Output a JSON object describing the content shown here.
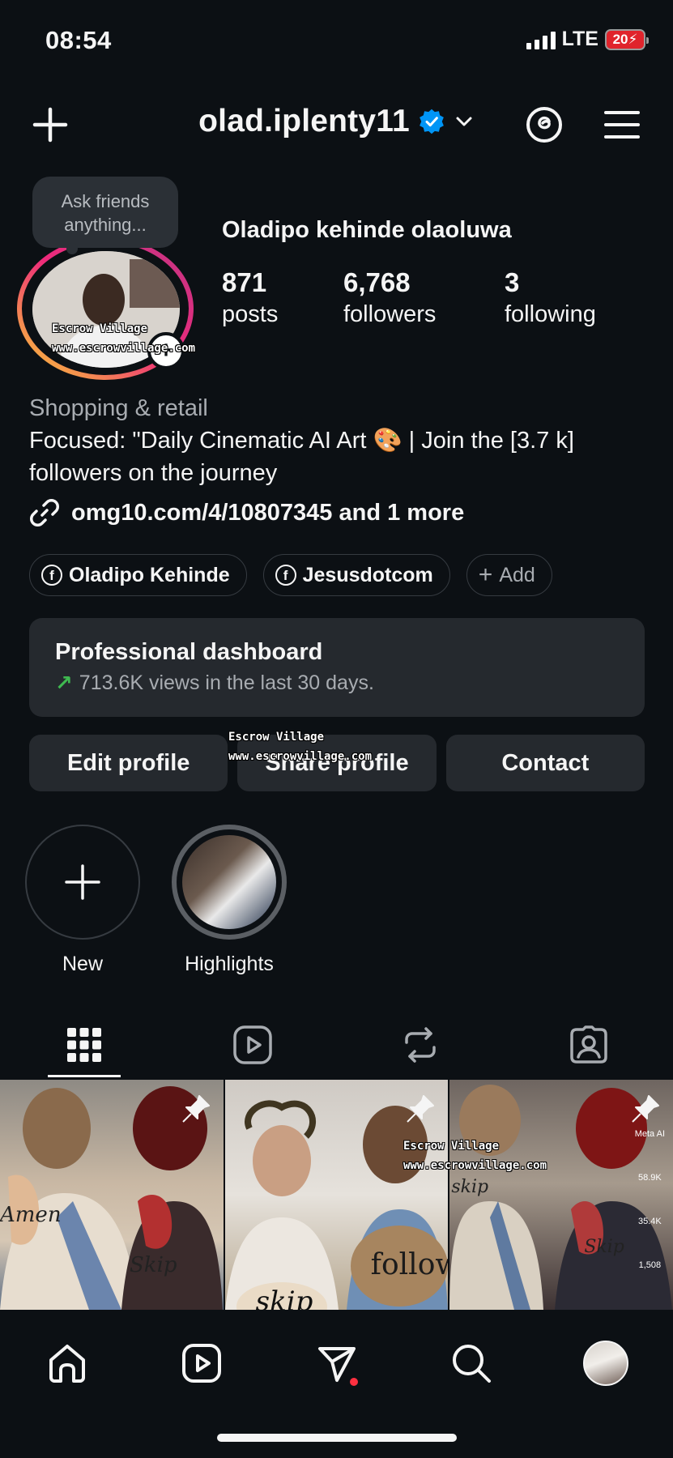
{
  "status_bar": {
    "time": "08:54",
    "network": "LTE",
    "battery": "20"
  },
  "header": {
    "username": "olad.iplenty11",
    "verified_icon": "verified-badge-icon"
  },
  "profile": {
    "note": "Ask friends anything...",
    "full_name": "Oladipo kehinde olaoluwa",
    "stats": [
      {
        "value": "871",
        "label": "posts"
      },
      {
        "value": "6,768",
        "label": "followers"
      },
      {
        "value": "3",
        "label": "following"
      }
    ],
    "category": "Shopping & retail",
    "bio": "Focused: \"Daily Cinematic AI Art 🎨 | Join the [3.7 k] followers on the journey",
    "link": "omg10.com/4/10807345 and 1 more",
    "linked_accounts": [
      "Oladipo Kehinde",
      "Jesusdotcom"
    ],
    "add_label": "Add"
  },
  "dashboard": {
    "title": "Professional dashboard",
    "subtitle": "713.6K views in the last 30 days."
  },
  "buttons": {
    "edit": "Edit profile",
    "share": "Share profile",
    "contact": "Contact"
  },
  "highlights": [
    {
      "label": "New"
    },
    {
      "label": "Highlights"
    }
  ],
  "watermark": {
    "line1": "Escrow Village",
    "line2": "www.escrowvillage.com"
  },
  "grid_text": {
    "amen": "Amen",
    "skip": "Skip",
    "skip2": "skip",
    "follow": "follow",
    "skip3": "skip",
    "meta": "Meta AI",
    "likes": "58.9K",
    "comments": "35.4K",
    "shares": "1,508"
  },
  "nav": {
    "items": [
      "home-icon",
      "reels-icon",
      "messages-icon",
      "search-icon",
      "profile-avatar"
    ]
  },
  "colors": {
    "background": "#0c1014",
    "card": "#25292e",
    "verified": "#0095f6",
    "trend": "#3fb950",
    "notification": "#ff3040"
  }
}
